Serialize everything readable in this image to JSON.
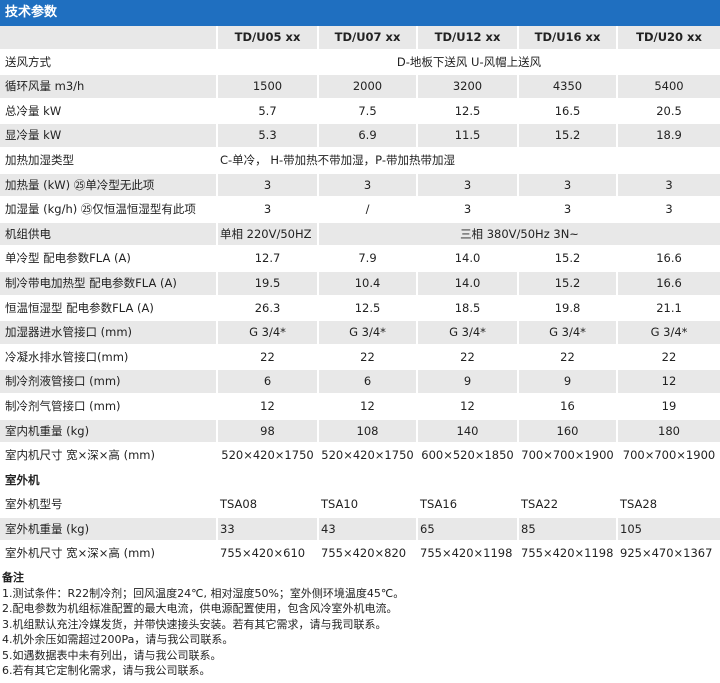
{
  "title": "技术参数",
  "header": [
    "",
    "TD/U05 xx",
    "TD/U07 xx",
    "TD/U12 xx",
    "TD/U16 xx",
    "TD/U20 xx"
  ],
  "indoor_rows": [
    {
      "label": "送风方式",
      "span": "D-地板下送风 U-风帽上送风"
    },
    {
      "label": "循环风量 m3/h",
      "values": [
        "1500",
        "2000",
        "3200",
        "4350",
        "5400"
      ]
    },
    {
      "label": "总冷量 kW",
      "values": [
        "5.7",
        "7.5",
        "12.5",
        "16.5",
        "20.5"
      ]
    },
    {
      "label": "显冷量 kW",
      "values": [
        "5.3",
        "6.9",
        "11.5",
        "15.2",
        "18.9"
      ]
    },
    {
      "label": "加热加湿类型",
      "span": "C-单冷， H-带加热不带加湿，P-带加热带加湿"
    },
    {
      "label": "加热量 (kW) ㉕单冷型无此项",
      "values": [
        "3",
        "3",
        "3",
        "3",
        "3"
      ]
    },
    {
      "label": "加湿量 (kg/h) ㉕仅恒温恒湿型有此项",
      "values": [
        "3",
        "/",
        "3",
        "3",
        "3"
      ]
    },
    {
      "label": "机组供电",
      "first": "单相 220V/50HZ",
      "rest": "三相 380V/50Hz 3N~"
    },
    {
      "label": "单冷型 配电参数FLA (A)",
      "values": [
        "12.7",
        "7.9",
        "14.0",
        "15.2",
        "16.6"
      ]
    },
    {
      "label": "制冷带电加热型 配电参数FLA (A)",
      "values": [
        "19.5",
        "10.4",
        "14.0",
        "15.2",
        "16.6"
      ]
    },
    {
      "label": "恒温恒湿型 配电参数FLA (A)",
      "values": [
        "26.3",
        "12.5",
        "18.5",
        "19.8",
        "21.1"
      ]
    },
    {
      "label": "加湿器进水管接口 (mm)",
      "values": [
        "G 3/4*",
        "G 3/4*",
        "G 3/4*",
        "G 3/4*",
        "G 3/4*"
      ]
    },
    {
      "label": "冷凝水排水管接口(mm)",
      "values": [
        "22",
        "22",
        "22",
        "22",
        "22"
      ]
    },
    {
      "label": "制冷剂液管接口 (mm)",
      "values": [
        "6",
        "6",
        "9",
        "9",
        "12"
      ]
    },
    {
      "label": "制冷剂气管接口 (mm)",
      "values": [
        "12",
        "12",
        "12",
        "16",
        "19"
      ]
    },
    {
      "label": "室内机重量 (kg)",
      "values": [
        "98",
        "108",
        "140",
        "160",
        "180"
      ]
    },
    {
      "label": "室内机尺寸 宽×深×高 (mm)",
      "values": [
        "520×420×1750",
        "520×420×1750",
        "600×520×1850",
        "700×700×1900",
        "700×700×1900"
      ]
    }
  ],
  "outdoor_title": "室外机",
  "outdoor_rows": [
    {
      "label": "室外机型号",
      "values": [
        "TSA08",
        "TSA10",
        "TSA16",
        "TSA22",
        "TSA28"
      ]
    },
    {
      "label": "室外机重量 (kg)",
      "values": [
        "33",
        "43",
        "65",
        "85",
        "105"
      ]
    },
    {
      "label": "室外机尺寸 宽×深×高 (mm)",
      "values": [
        "755×420×610",
        "755×420×820",
        "755×420×1198",
        "755×420×1198",
        "925×470×1367"
      ]
    }
  ],
  "notes_title": "备注",
  "notes": [
    "1.测试条件：R22制冷剂；回风温度24℃, 相对湿度50%；室外侧环境温度45℃。",
    "2.配电参数为机组标准配置的最大电流，供电源配置使用，包含风冷室外机电流。",
    "3.机组默认充注冷媒发货，并带快速接头安装。若有其它需求，请与我司联系。",
    "4.机外余压如需超过200Pa，请与我公司联系。",
    "5.如遇数据表中未有列出，请与我公司联系。",
    "6.若有其它定制化需求，请与我公司联系。"
  ]
}
